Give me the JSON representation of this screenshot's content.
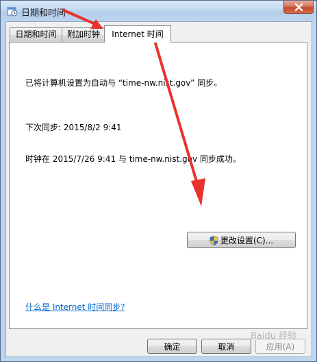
{
  "window": {
    "title": "日期和时间"
  },
  "tabs": [
    {
      "label": "日期和时间"
    },
    {
      "label": "附加时钟"
    },
    {
      "label": "Internet 时间"
    }
  ],
  "internet_time": {
    "sync_status": "已将计算机设置为自动与 “time-nw.nist.gov” 同步。",
    "next_sync": "下次同步: 2015/8/2 9:41",
    "last_sync": "时钟在 2015/7/26 9:41 与 time-nw.nist.gov 同步成功。",
    "change_settings_label": "更改设置(C)...",
    "help_link": "什么是 Internet 时间同步?"
  },
  "footer": {
    "ok_label": "确定",
    "cancel_label": "取消",
    "apply_label": "应用(A)"
  },
  "watermark": "Baidu 经验",
  "colors": {
    "annotation_arrow": "#e8322d",
    "link": "#0066cc",
    "close_button": "#c24a30"
  }
}
